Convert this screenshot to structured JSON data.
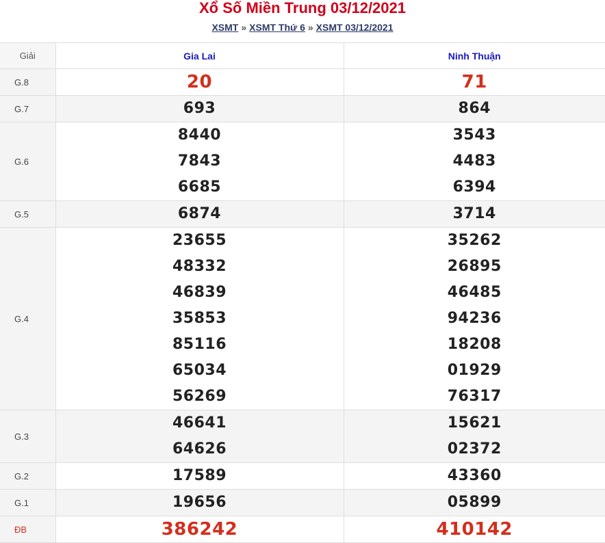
{
  "header": {
    "title": "Xổ Số Miền Trung 03/12/2021",
    "breadcrumb": [
      "XSMT",
      "XSMT Thứ 6",
      "XSMT 03/12/2021"
    ],
    "separator": "»"
  },
  "table": {
    "columns": [
      "Giải",
      "Gia Lai",
      "Ninh Thuận"
    ],
    "rows": [
      {
        "label": "G.8",
        "gia_lai": [
          "20"
        ],
        "ninh_thuan": [
          "71"
        ]
      },
      {
        "label": "G.7",
        "gia_lai": [
          "693"
        ],
        "ninh_thuan": [
          "864"
        ]
      },
      {
        "label": "G.6",
        "gia_lai": [
          "8440",
          "7843",
          "6685"
        ],
        "ninh_thuan": [
          "3543",
          "4483",
          "6394"
        ]
      },
      {
        "label": "G.5",
        "gia_lai": [
          "6874"
        ],
        "ninh_thuan": [
          "3714"
        ]
      },
      {
        "label": "G.4",
        "gia_lai": [
          "23655",
          "48332",
          "46839",
          "35853",
          "85116",
          "65034",
          "56269"
        ],
        "ninh_thuan": [
          "35262",
          "26895",
          "46485",
          "94236",
          "18208",
          "01929",
          "76317"
        ]
      },
      {
        "label": "G.3",
        "gia_lai": [
          "46641",
          "64626"
        ],
        "ninh_thuan": [
          "15621",
          "02372"
        ]
      },
      {
        "label": "G.2",
        "gia_lai": [
          "17589"
        ],
        "ninh_thuan": [
          "43360"
        ]
      },
      {
        "label": "G.1",
        "gia_lai": [
          "19656"
        ],
        "ninh_thuan": [
          "05899"
        ]
      },
      {
        "label": "ĐB",
        "gia_lai": [
          "386242"
        ],
        "ninh_thuan": [
          "410142"
        ]
      }
    ]
  },
  "colors": {
    "title": "#d0011b",
    "highlight_number": "#d32f1e",
    "province_header": "#1a1ab8",
    "breadcrumb": "#2b3a67"
  }
}
